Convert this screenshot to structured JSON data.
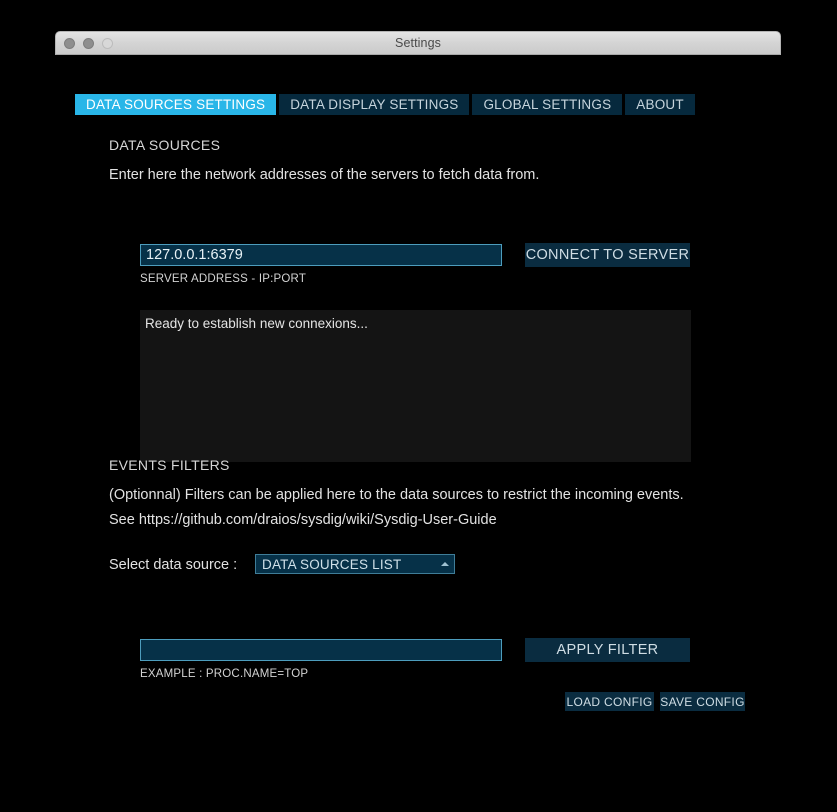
{
  "window": {
    "title": "Settings",
    "traffic_lights": [
      "close",
      "minimize",
      "zoom"
    ]
  },
  "tabs": [
    {
      "label": "DATA SOURCES SETTINGS",
      "active": true
    },
    {
      "label": "DATA DISPLAY SETTINGS",
      "active": false
    },
    {
      "label": "GLOBAL SETTINGS",
      "active": false
    },
    {
      "label": "ABOUT",
      "active": false
    }
  ],
  "data_sources": {
    "heading": "DATA SOURCES",
    "description": "Enter here the network addresses of the servers to fetch data from.",
    "server_address": {
      "value": "127.0.0.1:6379",
      "placeholder": "",
      "hint": "SERVER ADDRESS - IP:PORT"
    },
    "connect_button": "CONNECT TO SERVER",
    "log": "Ready to establish new connexions..."
  },
  "events_filters": {
    "heading": "EVENTS FILTERS",
    "description_line1": "(Optionnal) Filters can be applied here to the data sources to restrict the incoming events.",
    "description_line2": "See https://github.com/draios/sysdig/wiki/Sysdig-User-Guide",
    "select_label": "Select data source :",
    "select_value": "DATA SOURCES LIST",
    "select_arrow_icon": "triangle-up-icon",
    "filter_input": {
      "value": "",
      "placeholder": "",
      "hint": "EXAMPLE : PROC.NAME=TOP"
    },
    "apply_button": "APPLY FILTER"
  },
  "footer": {
    "load_config": "LOAD CONFIG",
    "save_config": "SAVE CONFIG"
  },
  "decor": {
    "corner_left": "\\",
    "corner_right": "/"
  },
  "colors": {
    "accent_active_tab": "#29b6e8",
    "tab_bg": "#06293d",
    "field_bg": "#063148",
    "field_border": "#4d9dbd",
    "button_bg": "#0a2c40",
    "log_bg": "#141414",
    "page_bg": "#000000"
  }
}
